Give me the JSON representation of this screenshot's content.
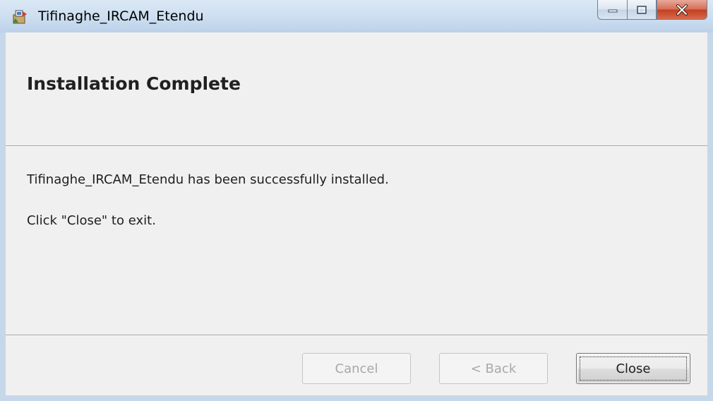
{
  "window": {
    "title": "Tifinaghe_IRCAM_Etendu",
    "icon": "installer-package-icon",
    "caption_buttons": [
      "minimize-icon",
      "maximize-icon",
      "close-icon"
    ]
  },
  "header": {
    "title": "Installation Complete"
  },
  "body": {
    "message_1": "Tifinaghe_IRCAM_Etendu has been successfully installed.",
    "message_2": "Click \"Close\" to exit."
  },
  "buttons": {
    "cancel": "Cancel",
    "back": "< Back",
    "close": "Close"
  }
}
